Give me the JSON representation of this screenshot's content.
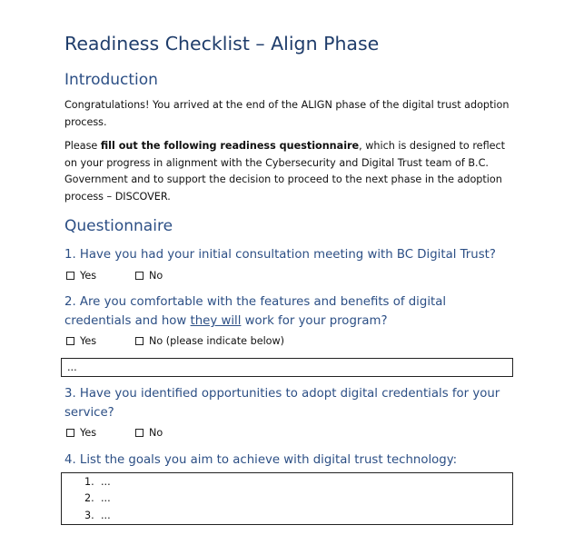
{
  "document": {
    "title": "Readiness Checklist – Align Phase",
    "introduction": {
      "heading": "Introduction",
      "paragraph1": "Congratulations! You arrived at the end of the ALIGN phase of the digital trust adoption process.",
      "paragraph2_before": "Please ",
      "paragraph2_bold": "fill out the following readiness questionnaire",
      "paragraph2_after": ", which is designed to reflect on your progress in alignment with the Cybersecurity and Digital Trust team of B.C. Government and to support the decision to proceed to the next phase in the adoption process – DISCOVER."
    },
    "questionnaire": {
      "heading": "Questionnaire",
      "q1": {
        "text": "1. Have you had your initial consultation meeting with BC Digital Trust?",
        "yes": "Yes",
        "no": "No"
      },
      "q2": {
        "text_before": "2. Are you comfortable with the features and benefits of digital credentials and how ",
        "text_underlined": "they will",
        "text_after": " work for your program?",
        "yes": "Yes",
        "no": "No (please indicate below)",
        "answer": "..."
      },
      "q3": {
        "text": "3. Have you identified opportunities to adopt digital credentials for your service?",
        "yes": "Yes",
        "no": "No"
      },
      "q4": {
        "text": "4. List the goals you aim to achieve with digital trust technology:",
        "goals": [
          {
            "num": "1.",
            "value": "..."
          },
          {
            "num": "2.",
            "value": "..."
          },
          {
            "num": "3.",
            "value": "..."
          }
        ]
      }
    }
  },
  "colors": {
    "heading": "#1f3d6b",
    "subheading": "#2c4f85",
    "text": "#111111"
  }
}
